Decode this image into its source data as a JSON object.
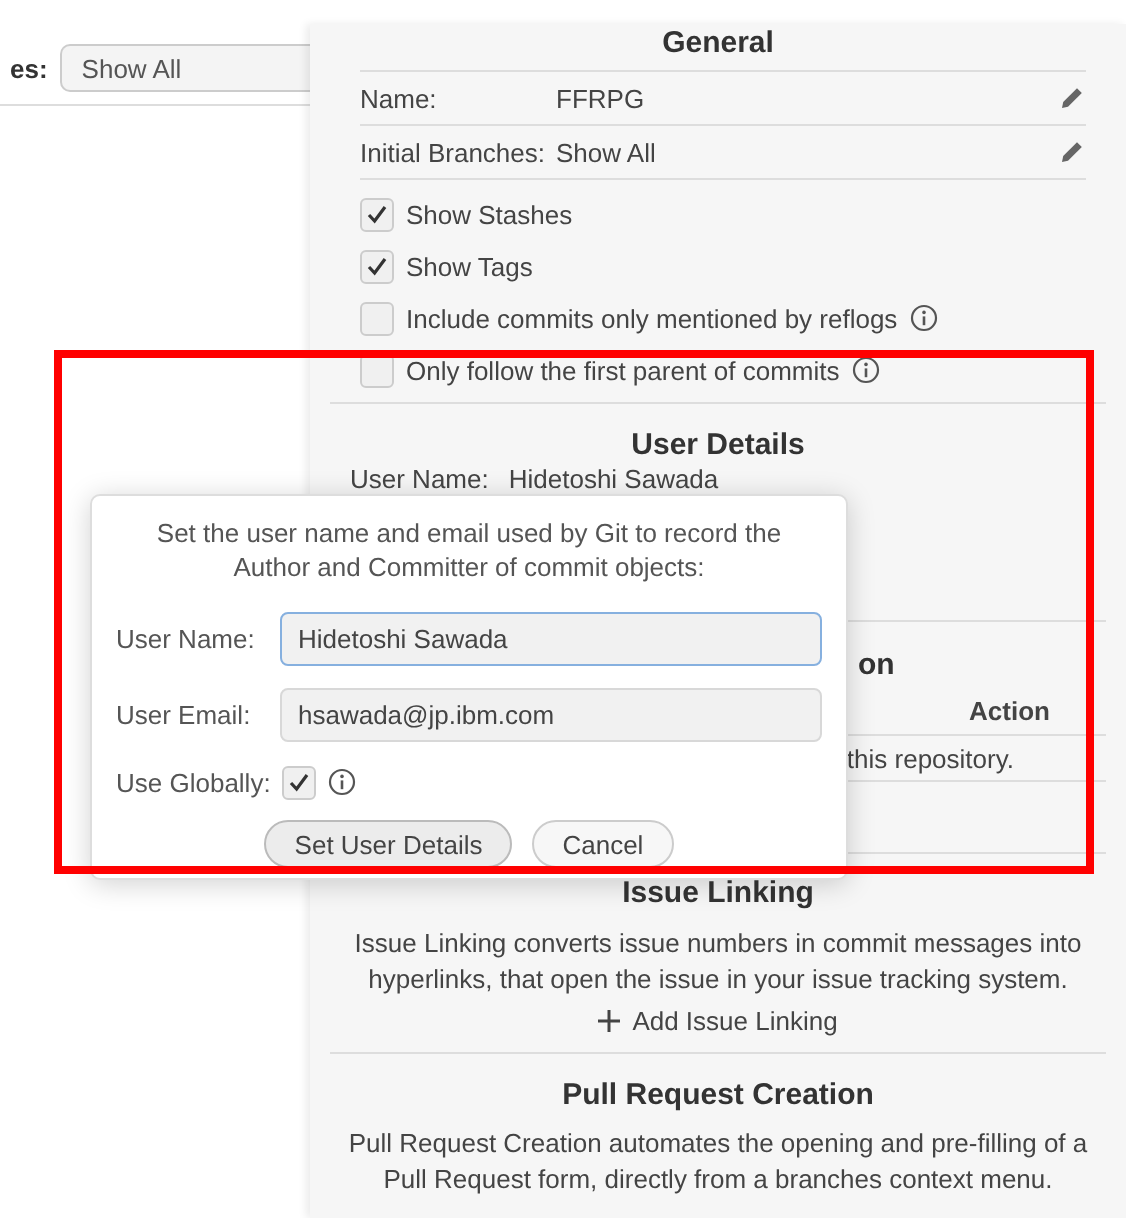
{
  "filter": {
    "label": "es:",
    "value": "Show All"
  },
  "general": {
    "title": "General",
    "properties": [
      {
        "label": "Name:",
        "value": "FFRPG"
      },
      {
        "label": "Initial Branches:",
        "value": "Show All"
      }
    ],
    "options": [
      {
        "label": "Show Stashes",
        "checked": true,
        "info": false
      },
      {
        "label": "Show Tags",
        "checked": true,
        "info": false
      },
      {
        "label": "Include commits only mentioned by reflogs",
        "checked": false,
        "info": true
      },
      {
        "label": "Only follow the first parent of commits",
        "checked": false,
        "info": true
      }
    ]
  },
  "user_details": {
    "title": "User Details",
    "label": "User Name:",
    "value": "Hidetoshi Sawada"
  },
  "section_3": {
    "title": "on",
    "column_header": "Action",
    "text": "this repository."
  },
  "issue_linking": {
    "title": "Issue Linking",
    "description": "Issue Linking converts issue numbers in commit messages into hyperlinks, that open the issue in your issue tracking system.",
    "action": "Add Issue Linking"
  },
  "pull_request": {
    "title": "Pull Request Creation",
    "description": "Pull Request Creation automates the opening and pre-filling of a Pull Request form, directly from a branches context menu."
  },
  "dialog": {
    "message": "Set the user name and email used by Git to record the Author and Committer of commit objects:",
    "fields": [
      {
        "label": "User Name:",
        "value": "Hidetoshi Sawada",
        "focused": true
      },
      {
        "label": "User Email:",
        "value": "hsawada@jp.ibm.com",
        "focused": false
      }
    ],
    "use_globally": {
      "label": "Use Globally:",
      "checked": true
    },
    "buttons": [
      {
        "label": "Set User Details",
        "default": true
      },
      {
        "label": "Cancel",
        "default": false
      }
    ]
  }
}
